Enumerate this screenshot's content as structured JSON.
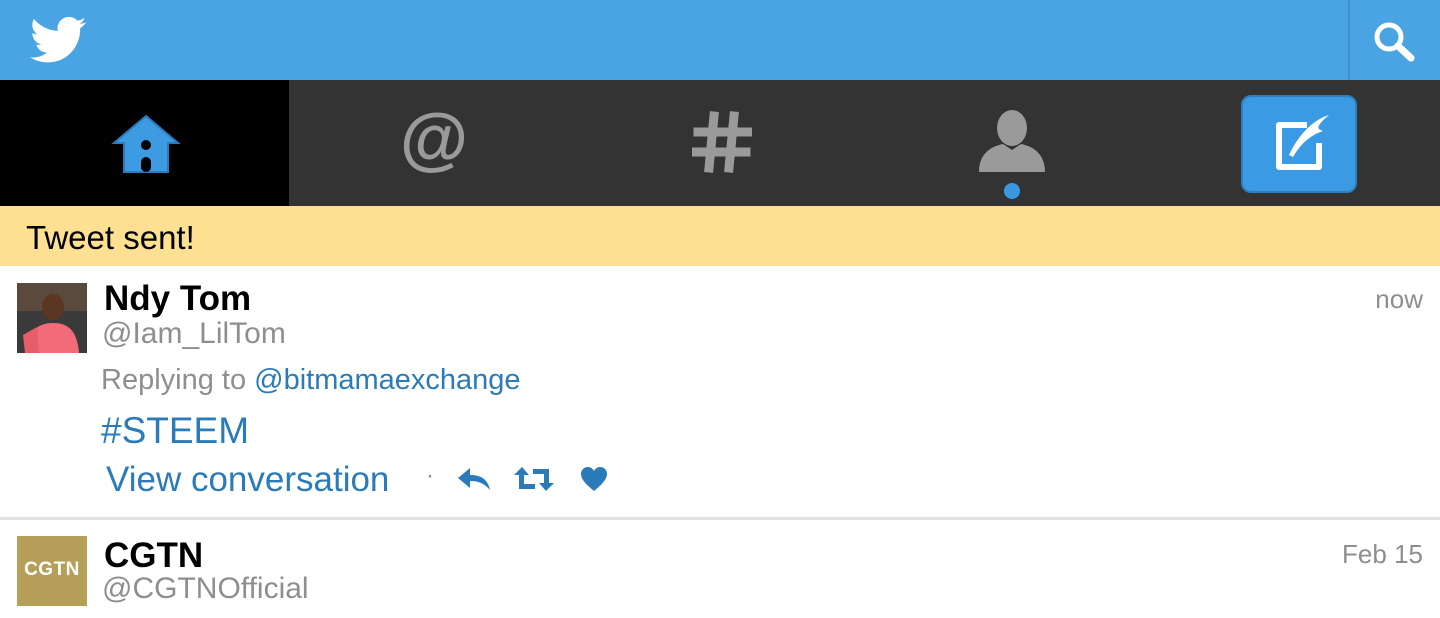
{
  "header": {
    "logo_icon": "twitter-bird-icon",
    "search_icon": "search-icon",
    "bar_color": "#4aa3e2"
  },
  "nav": {
    "tabs": [
      {
        "id": "home",
        "icon": "home-icon",
        "active": true
      },
      {
        "id": "connect",
        "icon": "at-sign-icon",
        "active": false
      },
      {
        "id": "discover",
        "icon": "hashtag-icon",
        "active": false
      },
      {
        "id": "me",
        "icon": "person-icon",
        "active": false,
        "unread_dot": true
      },
      {
        "id": "compose",
        "icon": "compose-icon",
        "active": false
      }
    ]
  },
  "notification": {
    "text": "Tweet sent!",
    "bg_color": "#fde092"
  },
  "timeline": {
    "tweets": [
      {
        "name": "Ndy Tom",
        "handle": "@Iam_LilTom",
        "time": "now",
        "replying_prefix": "Replying to ",
        "replying_to": "@bitmamaexchange",
        "text": "#STEEM",
        "view_conversation": "View conversation",
        "separator": "·",
        "actions": [
          "reply-icon",
          "retweet-icon",
          "like-icon"
        ]
      },
      {
        "name": "CGTN",
        "handle": "@CGTNOfficial",
        "time": "Feb 15",
        "avatar_text": "CGTN"
      }
    ]
  },
  "colors": {
    "link": "#2b7bb9",
    "muted": "#8e8e8e",
    "nav_bg": "#333333"
  }
}
